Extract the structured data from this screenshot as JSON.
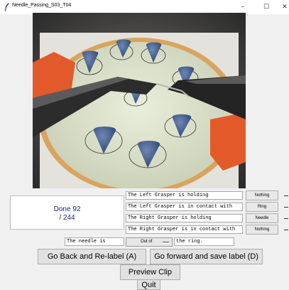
{
  "window": {
    "title": "Needle_Passing_S03_T04",
    "minimize": "–",
    "maximize": "☐",
    "close": "✕"
  },
  "progress": {
    "line1": "Done 92",
    "line2": "/ 244"
  },
  "rows": [
    {
      "text": "The Left Grasper is holding",
      "button": "Nothing"
    },
    {
      "text": "The Left Grasper is in contact with",
      "button": "Ring"
    },
    {
      "text": "The Right Grasper is holding",
      "button": "Needle"
    },
    {
      "text": "The Right Grasper is in contact with",
      "button": "Nothing"
    }
  ],
  "needle": {
    "label": "The needle is",
    "option": "Out of",
    "suffix": "the ring."
  },
  "buttons": {
    "back": "Go Back and Re-label (A)",
    "forward": "Go forward and save label (D)",
    "preview": "Preview Clip",
    "quit": "Quit"
  },
  "colors": {
    "progress_text": "#1a1a9a",
    "background": "#f0f0f0"
  }
}
